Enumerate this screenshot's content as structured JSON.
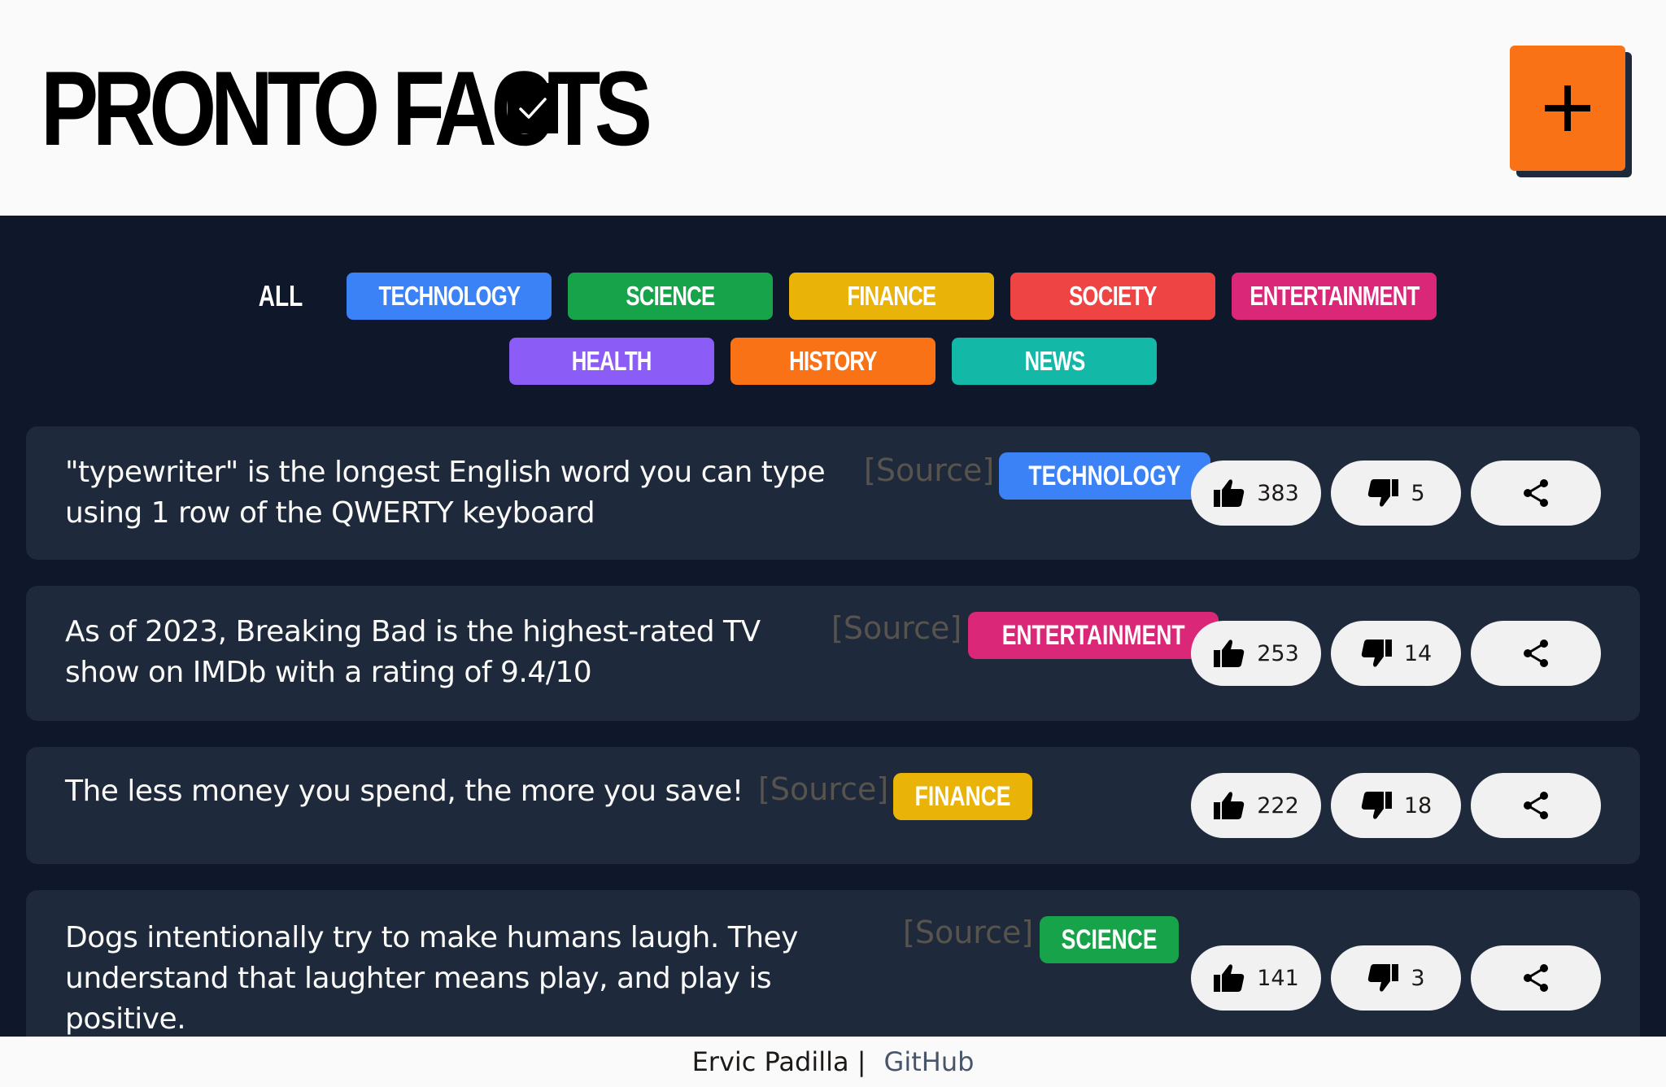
{
  "header": {
    "title": "PRONTO FACTS",
    "add_button_label": "+"
  },
  "categories": {
    "all_label": "ALL",
    "items": [
      {
        "label": "TECHNOLOGY",
        "color": "#3b82f6"
      },
      {
        "label": "SCIENCE",
        "color": "#16a34a"
      },
      {
        "label": "FINANCE",
        "color": "#eab308"
      },
      {
        "label": "SOCIETY",
        "color": "#ef4444"
      },
      {
        "label": "ENTERTAINMENT",
        "color": "#db2777"
      },
      {
        "label": "HEALTH",
        "color": "#8b5cf6"
      },
      {
        "label": "HISTORY",
        "color": "#f97316"
      },
      {
        "label": "NEWS",
        "color": "#14b8a6"
      }
    ]
  },
  "facts": [
    {
      "text": "\"typewriter\" is the longest English word you can type using 1 row of the QWERTY keyboard",
      "source_label": "[Source]",
      "category": "TECHNOLOGY",
      "category_color": "#3b82f6",
      "likes": "383",
      "dislikes": "5"
    },
    {
      "text": "As of 2023, Breaking Bad is the highest-rated TV show on IMDb with a rating of 9.4/10",
      "source_label": "[Source]",
      "category": "ENTERTAINMENT",
      "category_color": "#db2777",
      "likes": "253",
      "dislikes": "14"
    },
    {
      "text": "The less money you spend, the more you save!",
      "source_label": "[Source]",
      "category": "FINANCE",
      "category_color": "#eab308",
      "likes": "222",
      "dislikes": "18"
    },
    {
      "text": "Dogs intentionally try to make humans laugh. They understand that laughter means play, and play is positive.",
      "source_label": "[Source]",
      "category": "SCIENCE",
      "category_color": "#16a34a",
      "likes": "141",
      "dislikes": "3"
    }
  ],
  "footer": {
    "author": "Ervic Padilla |",
    "link_label": "GitHub"
  }
}
